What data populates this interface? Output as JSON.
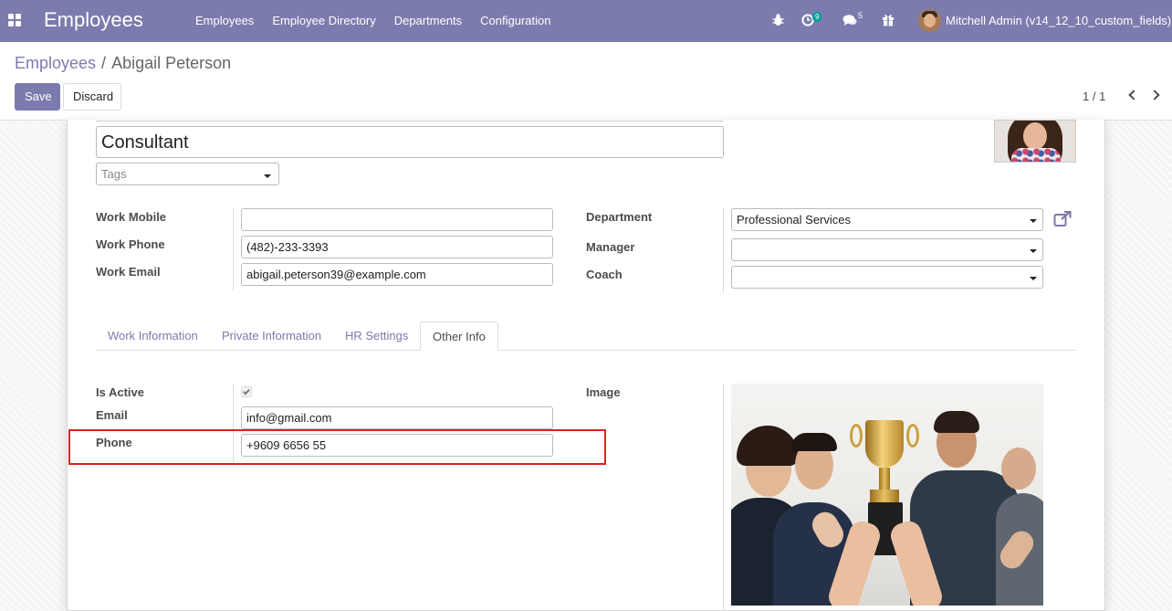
{
  "navbar": {
    "brand": "Employees",
    "menu": [
      "Employees",
      "Employee Directory",
      "Departments",
      "Configuration"
    ],
    "activity_count": "9",
    "messages_count": "5",
    "user": "Mitchell Admin (v14_12_10_custom_fields)",
    "accent_color": "#7c7bad"
  },
  "breadcrumb": {
    "parent": "Employees",
    "separator": "/",
    "current": "Abigail Peterson"
  },
  "toolbar": {
    "save_label": "Save",
    "discard_label": "Discard",
    "pager": "1 / 1"
  },
  "form": {
    "job_title": "Consultant",
    "tags_placeholder": "Tags",
    "left_fields": [
      {
        "label": "Work Mobile",
        "value": ""
      },
      {
        "label": "Work Phone",
        "value": "(482)-233-3393"
      },
      {
        "label": "Work Email",
        "value": "abigail.peterson39@example.com"
      }
    ],
    "right_fields": [
      {
        "label": "Department",
        "value": "Professional Services"
      },
      {
        "label": "Manager",
        "value": ""
      },
      {
        "label": "Coach",
        "value": ""
      }
    ]
  },
  "tabs": [
    {
      "label": "Work Information",
      "active": false
    },
    {
      "label": "Private Information",
      "active": false
    },
    {
      "label": "HR Settings",
      "active": false
    },
    {
      "label": "Other Info",
      "active": true
    }
  ],
  "other_info": {
    "is_active_label": "Is Active",
    "is_active": true,
    "email_label": "Email",
    "email_value": "info@gmail.com",
    "phone_label": "Phone",
    "phone_value": "+9609 6656 55",
    "image_label": "Image",
    "highlight_color": "#e0201e"
  }
}
